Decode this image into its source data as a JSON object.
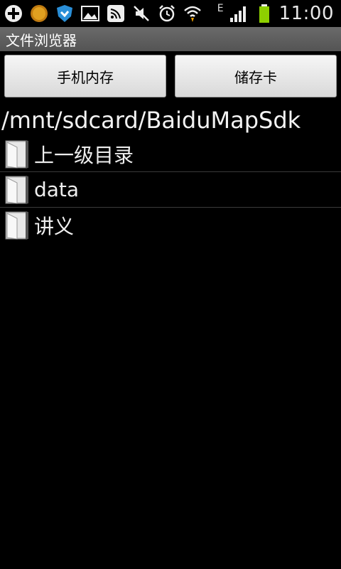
{
  "status_bar": {
    "icons_left": [
      "add-icon",
      "circle-app-icon",
      "shield-icon",
      "image-icon",
      "sound-wave-icon",
      "mute-icon",
      "alarm-icon",
      "wifi-icon"
    ],
    "network": "E",
    "icons_right": [
      "signal-icon",
      "battery-icon"
    ],
    "time": "11:00",
    "battery_color": "#8ed000"
  },
  "app": {
    "title": "文件浏览器"
  },
  "buttons": {
    "phone_memory": "手机内存",
    "sd_card": "储存卡"
  },
  "path": "/mnt/sdcard/BaiduMapSdk",
  "files": [
    {
      "label": "上一级目录",
      "icon": "folder-icon"
    },
    {
      "label": "data",
      "icon": "folder-icon"
    },
    {
      "label": "讲义",
      "icon": "folder-icon"
    }
  ]
}
